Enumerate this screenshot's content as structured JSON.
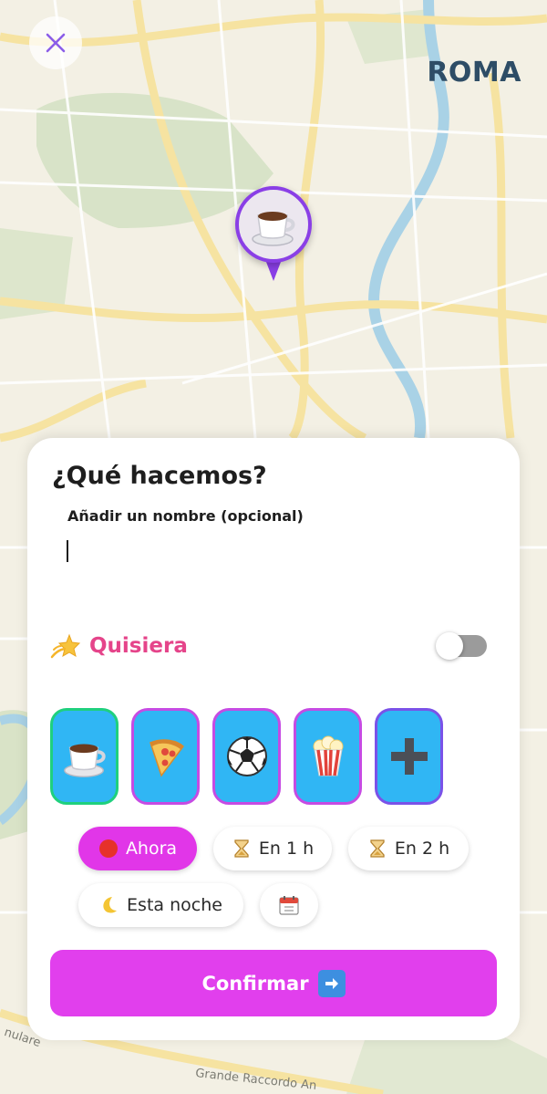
{
  "map": {
    "city": "ROMA",
    "streets": [
      "nulare",
      "Grande Raccordo An"
    ]
  },
  "sheet": {
    "title": "¿Qué hacemos?",
    "name_label": "Añadir un nombre (opcional)",
    "name_value": "",
    "wish_label": "Quisiera",
    "wish_toggle_on": false
  },
  "activities": [
    {
      "icon": "coffee-icon",
      "selected": true
    },
    {
      "icon": "pizza-icon",
      "selected": false
    },
    {
      "icon": "soccer-ball-icon",
      "selected": false
    },
    {
      "icon": "popcorn-icon",
      "selected": false
    },
    {
      "icon": "plus-icon",
      "selected": false
    }
  ],
  "times": {
    "now": "Ahora",
    "in1": "En 1 h",
    "in2": "En 2 h",
    "tonight": "Esta noche"
  },
  "confirm_label": "Confirmar",
  "colors": {
    "accent": "#e13fed",
    "pink": "#e5448a",
    "tile": "#30b6f4",
    "pin_border": "#8a3fe6"
  }
}
